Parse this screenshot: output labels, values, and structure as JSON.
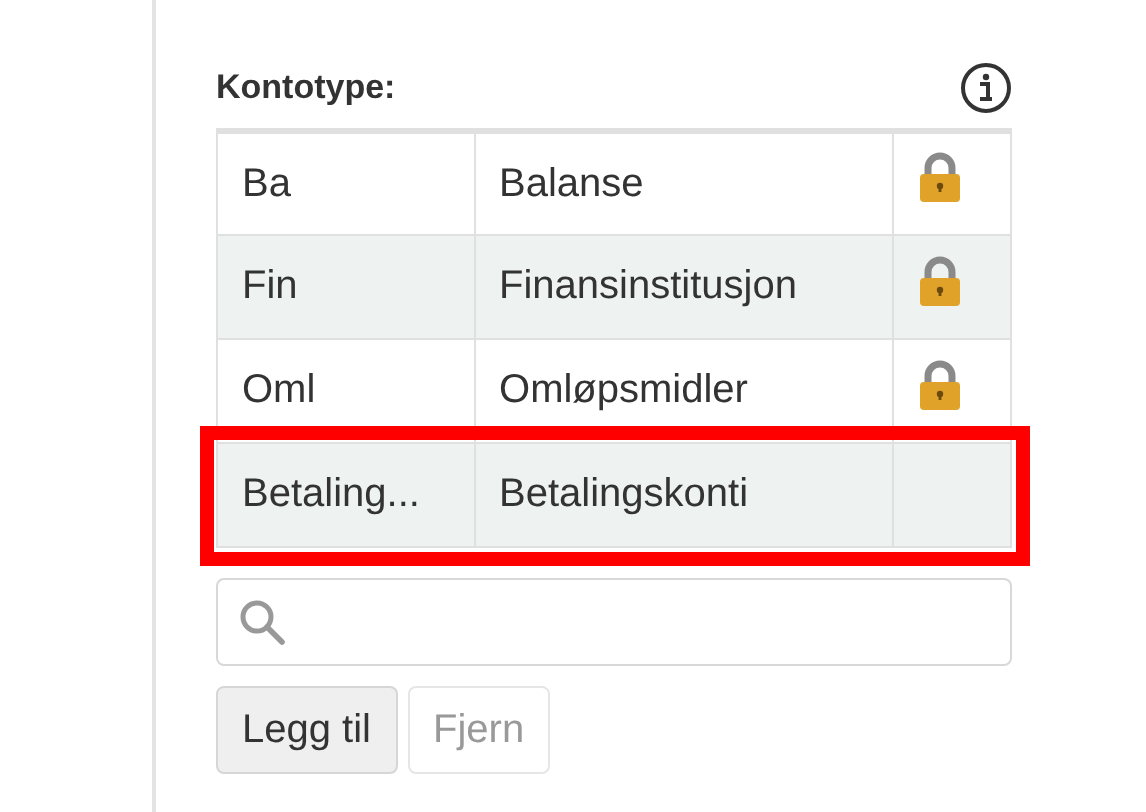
{
  "field_label": "Kontotype:",
  "rows": [
    {
      "code": "Ba",
      "name": "Balanse",
      "locked": true,
      "highlighted": false
    },
    {
      "code": "Fin",
      "name": "Finansinstitusjon",
      "locked": true,
      "highlighted": false
    },
    {
      "code": "Oml",
      "name": "Omløpsmidler",
      "locked": true,
      "highlighted": false
    },
    {
      "code": "Betaling...",
      "name": "Betalingskonti",
      "locked": false,
      "highlighted": true
    }
  ],
  "buttons": [
    {
      "label": "Legg til",
      "disabled": false
    },
    {
      "label": "Fjern",
      "disabled": true
    }
  ]
}
